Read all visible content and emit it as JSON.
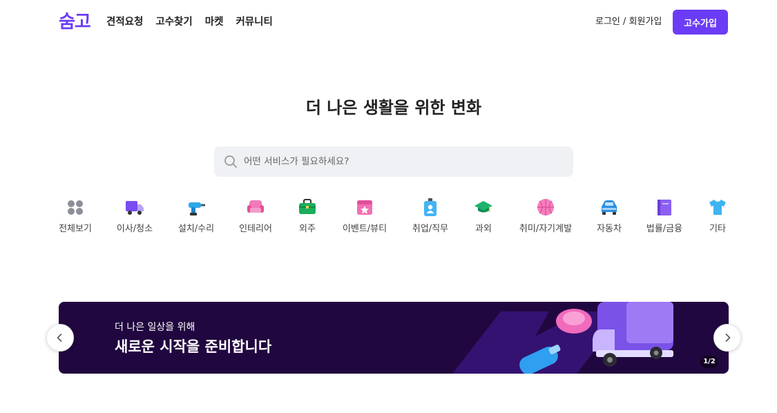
{
  "header": {
    "logo": "숨고",
    "nav": [
      "견적요청",
      "고수찾기",
      "마켓",
      "커뮤니티"
    ],
    "login_label": "로그인 / 회원가입",
    "pro_signup_label": "고수가입"
  },
  "hero": {
    "headline": "더 나은 생활을 위한 변화",
    "search_placeholder": "어떤 서비스가 필요하세요?"
  },
  "categories": [
    {
      "label": "전체보기",
      "icon": "grid-dots-icon"
    },
    {
      "label": "이사/청소",
      "icon": "moving-truck-icon"
    },
    {
      "label": "설치/수리",
      "icon": "drill-icon"
    },
    {
      "label": "인테리어",
      "icon": "armchair-icon"
    },
    {
      "label": "외주",
      "icon": "briefcase-icon"
    },
    {
      "label": "이벤트/뷰티",
      "icon": "calendar-star-icon"
    },
    {
      "label": "취업/직무",
      "icon": "id-badge-icon"
    },
    {
      "label": "과외",
      "icon": "graduation-cap-icon"
    },
    {
      "label": "취미/자기계발",
      "icon": "basketball-icon"
    },
    {
      "label": "자동차",
      "icon": "car-icon"
    },
    {
      "label": "법률/금융",
      "icon": "book-icon"
    },
    {
      "label": "기타",
      "icon": "tshirt-icon"
    }
  ],
  "banner": {
    "subtitle": "더 나은 일상을 위해",
    "title": "새로운 시작을 준비합니다",
    "pager": "1/2"
  },
  "colors": {
    "brand": "#6b3cf5",
    "banner_bg": "#21073f"
  }
}
